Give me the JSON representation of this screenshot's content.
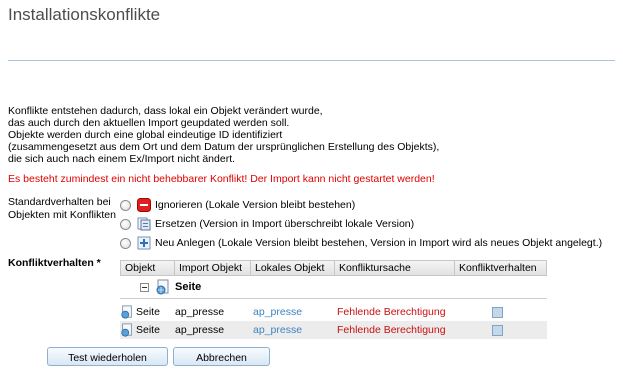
{
  "page": {
    "title": "Installationskonflikte"
  },
  "description": {
    "lines": [
      "Konflikte entstehen dadurch, dass lokal ein Objekt verändert wurde,",
      "das auch durch den aktuellen Import geupdated werden soll.",
      "Objekte werden durch eine global eindeutige ID identifiziert",
      "(zusammengesetzt aus dem Ort und dem Datum der ursprünglichen Erstellung des Objekts),",
      "die sich auch nach einem Ex/Import nicht ändert."
    ],
    "error": "Es besteht zumindest ein nicht behebbarer Konflikt! Der Import kann nicht gestartet werden!"
  },
  "standard": {
    "label": "Standardverhalten bei Objekten mit Konflikten",
    "options": [
      {
        "label": "Ignorieren (Lokale Version bleibt bestehen)",
        "icon": "stop-icon",
        "color": "#e02020"
      },
      {
        "label": "Ersetzen (Version in Import überschreibt lokale Version)",
        "icon": "replace-icon",
        "color": "#6a8ab0"
      },
      {
        "label": "Neu Anlegen (Lokale Version bleibt bestehen, Version in Import wird als neues Objekt angelegt.)",
        "icon": "add-icon",
        "color": "#2a6fc0"
      }
    ]
  },
  "conflicts": {
    "label": "Konfliktverhalten *",
    "columns": [
      "Objekt",
      "Import Objekt",
      "Lokales Objekt",
      "Konfliktursache",
      "Konfliktverhalten"
    ],
    "group": "Seite",
    "rows": [
      {
        "type": "Seite",
        "import": "ap_presse",
        "local": "ap_presse",
        "cause": "Fehlende Berechtigung"
      },
      {
        "type": "Seite",
        "import": "ap_presse",
        "local": "ap_presse",
        "cause": "Fehlende Berechtigung"
      }
    ]
  },
  "buttons": {
    "test": "Test wiederholen",
    "cancel": "Abbrechen"
  }
}
